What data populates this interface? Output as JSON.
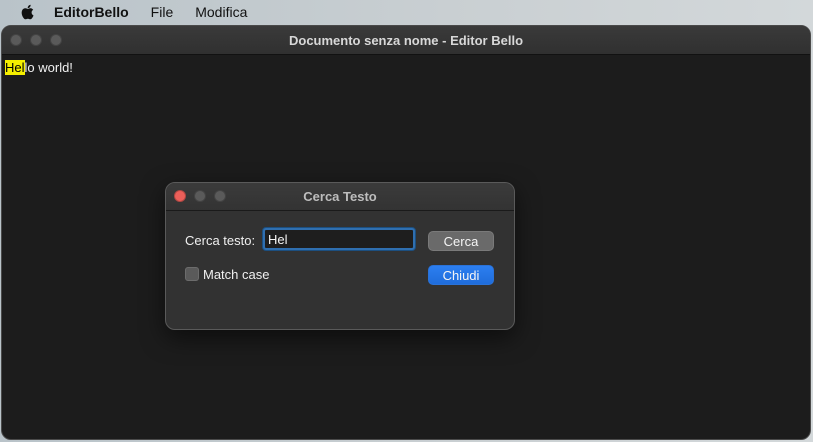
{
  "menubar": {
    "apple_icon": "apple-logo-icon",
    "app_name": "EditorBello",
    "items": [
      "File",
      "Modifica"
    ]
  },
  "main_window": {
    "title": "Documento senza nome - Editor Bello",
    "content": {
      "highlighted_text": "Hel",
      "rest_text": "lo world!"
    }
  },
  "find_dialog": {
    "title": "Cerca Testo",
    "search_label": "Cerca testo:",
    "search_value": "Hel",
    "match_case_label": "Match case",
    "match_case_checked": false,
    "search_button": "Cerca",
    "close_button": "Chiudi"
  },
  "colors": {
    "highlight": "#f5ef00",
    "primary_button": "#1f6ddb",
    "close_light": "#ec5f59"
  }
}
